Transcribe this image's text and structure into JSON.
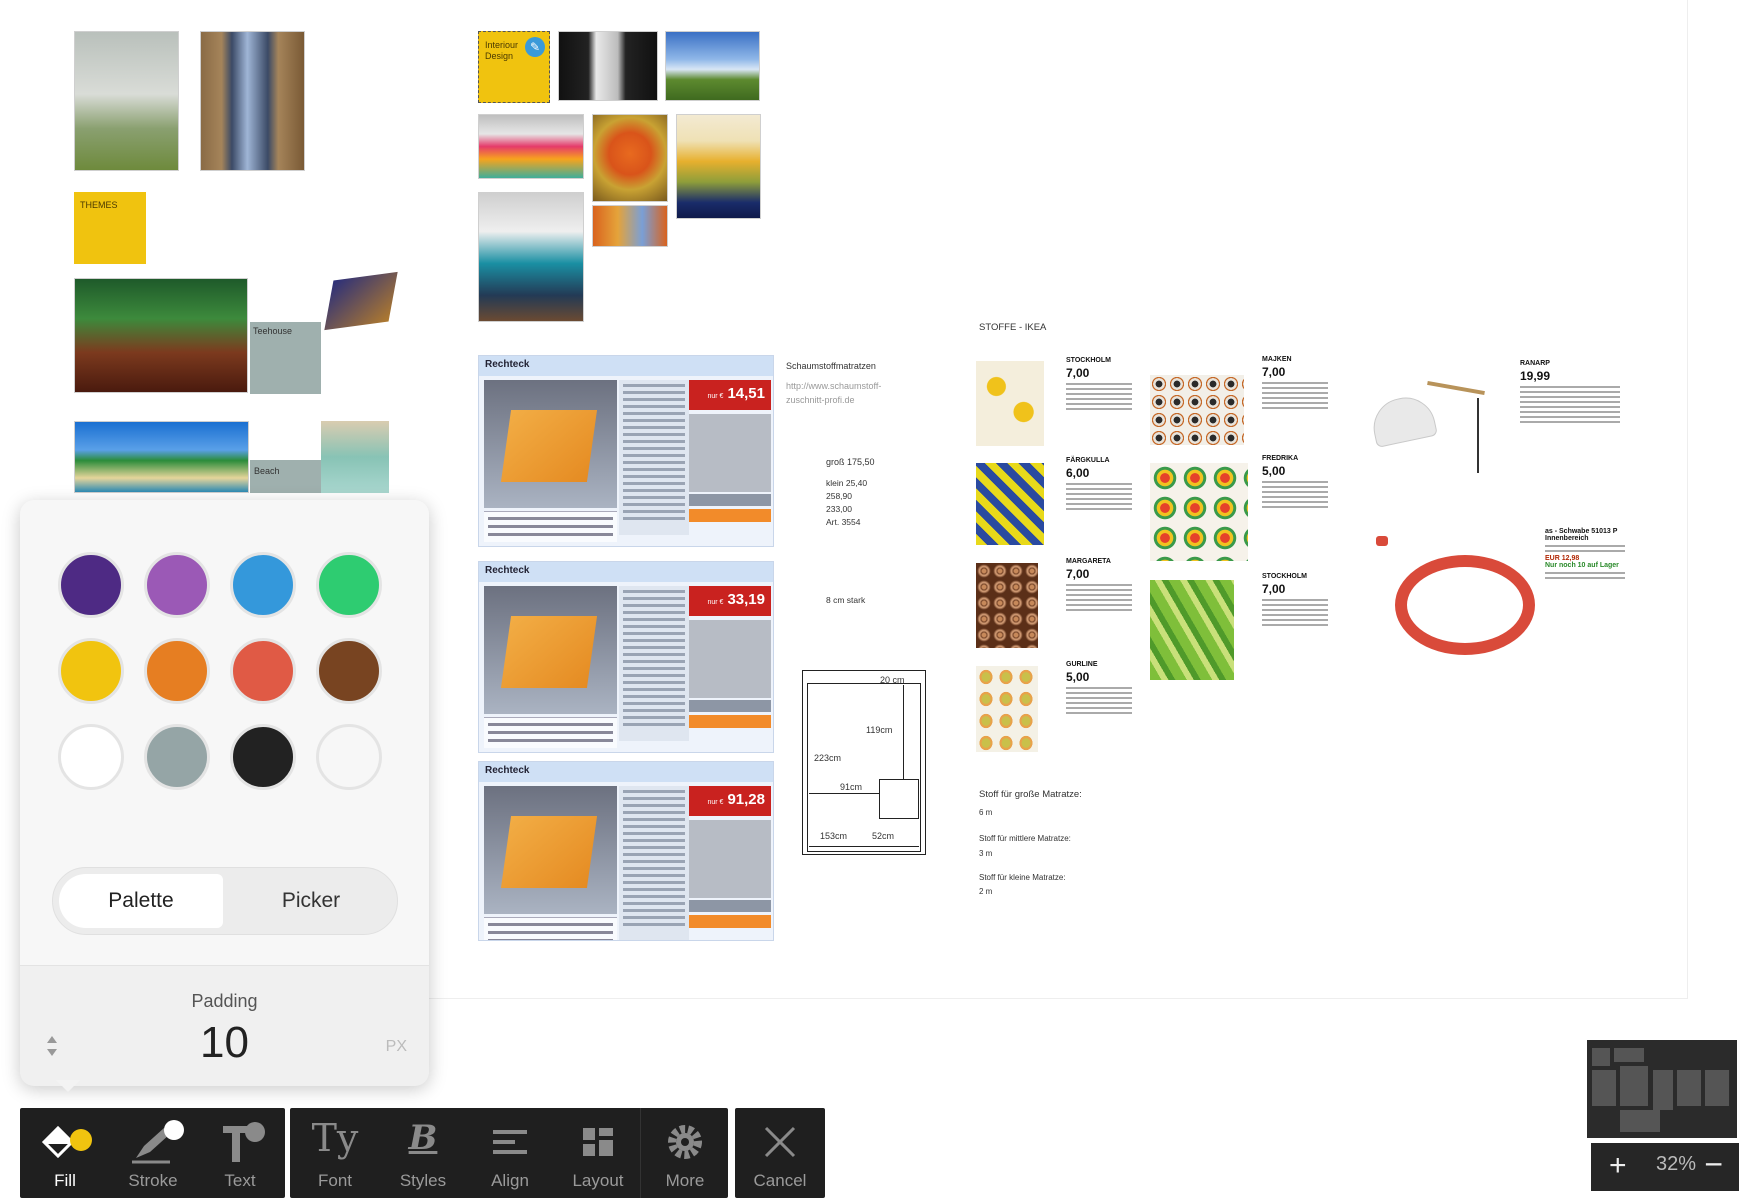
{
  "board": {
    "notes": {
      "interior_design": "Interiour Design",
      "themes": "THEMES"
    },
    "labels": {
      "teehouse": "Teehouse",
      "beach": "Beach",
      "stoffe_ikea": "STOFFE - IKEA"
    },
    "schaumstoff": {
      "title": "Schaumstoffmatratzen",
      "url_line1": "http://www.schaumstoff-",
      "url_line2": "zuschnitt-profi.de",
      "gross": "groß 175,50",
      "klein": "klein 25,40",
      "v1": "258,90",
      "v2": "233,00",
      "art": "Art. 3554",
      "stark": "8 cm stark"
    },
    "cards": [
      {
        "title": "Rechteck",
        "price": "14,51",
        "nur": "nur €"
      },
      {
        "title": "Rechteck",
        "price": "33,19",
        "nur": "nur €"
      },
      {
        "title": "Rechteck",
        "price": "91,28",
        "nur": "nur €"
      }
    ],
    "sketch": {
      "w20": "20 cm",
      "h119": "119cm",
      "h223": "223cm",
      "w91": "91cm",
      "w153": "153cm",
      "w52": "52cm"
    },
    "stoff_notes": {
      "gross_title": "Stoff für große Matratze:",
      "gross_val": "6 m",
      "mittel_title": "Stoff für mittlere Matratze:",
      "mittel_val": "3 m",
      "klein_title": "Stoff für kleine Matratze:",
      "klein_val": "2 m"
    },
    "ikea_col1": [
      {
        "name": "STOCKHOLM",
        "price": "7,00"
      },
      {
        "name": "FÄRGKULLA",
        "price": "6,00"
      },
      {
        "name": "MARGARETA",
        "price": "7,00"
      },
      {
        "name": "GURLINE",
        "price": "5,00"
      }
    ],
    "ikea_col2": [
      {
        "name": "MAJKEN",
        "price": "7,00"
      },
      {
        "name": "FREDRIKA",
        "price": "5,00"
      },
      {
        "name": "STOCKHOLM",
        "price": "7,00"
      }
    ],
    "lamp": {
      "name": "RANARP",
      "price": "19,99"
    },
    "cable": {
      "title": "as - Schwabe 51013 P Innenbereich",
      "price": "EUR 12,98",
      "stock": "Nur noch 10 auf Lager"
    }
  },
  "popover": {
    "colors": [
      "#4e2a84",
      "#9b59b6",
      "#3498db",
      "#2ecc71",
      "#f1c40f",
      "#e67e22",
      "#e05a45",
      "#784421",
      "#ffffff",
      "#95a5a6",
      "#222222",
      "#f7f7f7"
    ],
    "color_names": [
      "purple-dark",
      "purple",
      "blue",
      "green",
      "yellow",
      "orange",
      "red",
      "brown",
      "white",
      "gray",
      "black",
      "none"
    ],
    "tab_palette": "Palette",
    "tab_picker": "Picker",
    "padding_label": "Padding",
    "padding_value": "10",
    "padding_unit": "PX"
  },
  "toolbar": {
    "fill": "Fill",
    "stroke": "Stroke",
    "text": "Text",
    "font": "Font",
    "styles": "Styles",
    "align": "Align",
    "layout": "Layout",
    "more": "More",
    "cancel": "Cancel",
    "accent": "#f1c40f"
  },
  "zoom": {
    "plus": "+",
    "value": "32%",
    "minus": "−"
  }
}
